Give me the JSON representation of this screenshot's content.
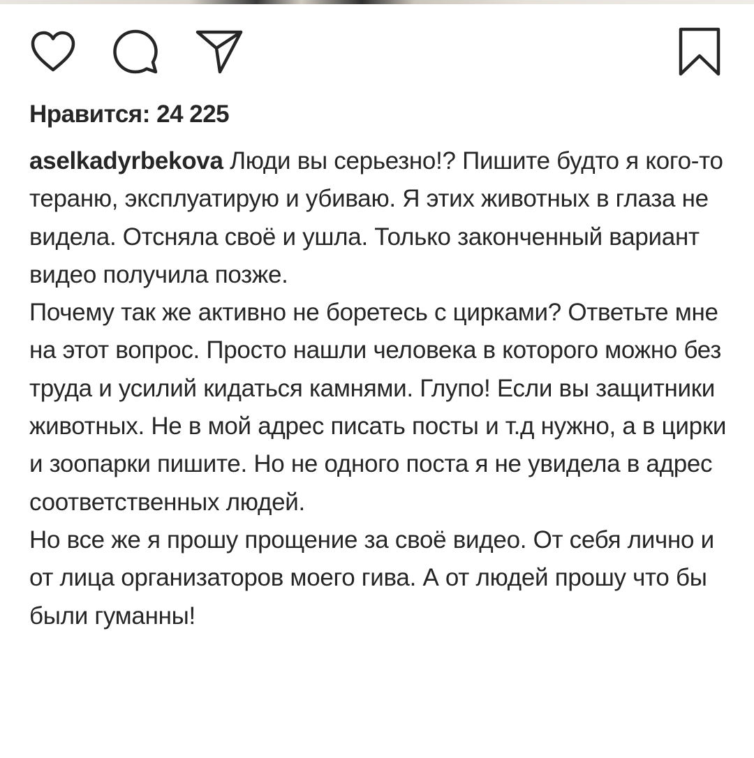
{
  "post": {
    "actions": {
      "like_icon": "heart-outline-icon",
      "comment_icon": "comment-bubble-icon",
      "share_icon": "paper-plane-icon",
      "save_icon": "bookmark-icon"
    },
    "likes_text": "Нравится: 24 225",
    "caption": {
      "username": "aselkadyrbekova",
      "paragraphs": [
        "Люди вы серьезно!? Пишите будто я кого-то тераню, эксплуатирую и убиваю. Я этих животных в глаза не видела. Отсняла  своё и ушла. Только законченный вариант видео получила позже.",
        "Почему так же активно не боретесь с цирками? Ответьте мне на этот вопрос. Просто нашли человека в которого можно без труда и усилий кидаться камнями. Глупо! Если вы защитники животных. Не в мой адрес писать посты и т.д нужно, а в цирки и зоопарки пишите. Но не одного поста я не увидела в адрес соответственных людей.",
        "Но все же я прошу прощение за своё видео. От себя лично и от лица организаторов моего гива. А от людей прошу что бы были гуманны!"
      ]
    }
  },
  "colors": {
    "text": "#262626",
    "icon_stroke": "#262626",
    "background": "#ffffff"
  }
}
